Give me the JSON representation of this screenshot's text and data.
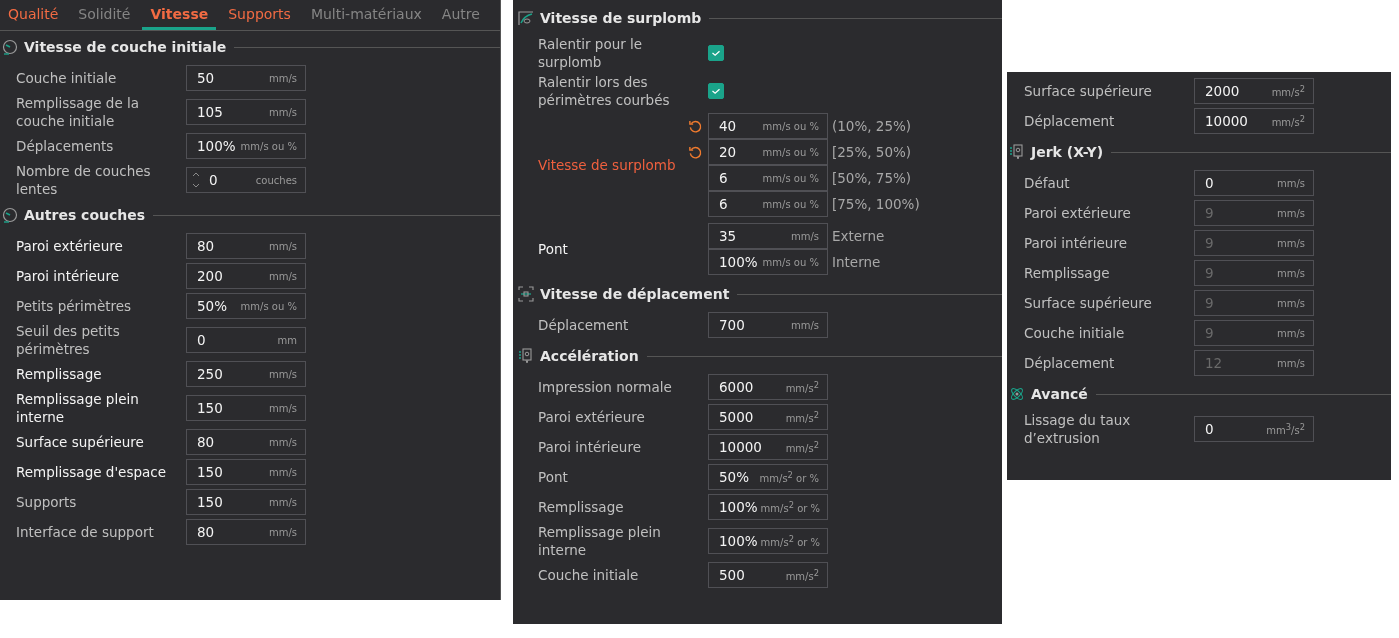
{
  "panels": [
    {
      "tabs": [
        {
          "label": "Qualité",
          "selected": false,
          "modified": true
        },
        {
          "label": "Solidité",
          "selected": false,
          "modified": false
        },
        {
          "label": "Vitesse",
          "selected": true,
          "modified": true
        },
        {
          "label": "Supports",
          "selected": false,
          "modified": true
        },
        {
          "label": "Multi-matériaux",
          "selected": false,
          "modified": false
        },
        {
          "label": "Autre",
          "selected": false,
          "modified": false
        }
      ],
      "sections": [
        {
          "title": "Vitesse de couche initiale",
          "kind": "gauge",
          "rows": [
            {
              "kind": "input",
              "label": "Couche initiale",
              "modified": false,
              "value": "50",
              "unit": "mm/s"
            },
            {
              "kind": "input",
              "label": "Remplissage de la couche initiale",
              "modified": false,
              "value": "105",
              "unit": "mm/s"
            },
            {
              "kind": "input",
              "label": "Déplacements",
              "modified": false,
              "value": "100%",
              "unit": "mm/s ou %"
            },
            {
              "kind": "spin",
              "label": "Nombre de couches lentes",
              "modified": false,
              "value": "0",
              "unit": "couches"
            }
          ]
        },
        {
          "title": "Autres couches",
          "kind": "gauge",
          "rows": [
            {
              "kind": "input",
              "label": "Paroi extérieure",
              "modified": true,
              "value": "80",
              "unit": "mm/s"
            },
            {
              "kind": "input",
              "label": "Paroi intérieure",
              "modified": true,
              "value": "200",
              "unit": "mm/s"
            },
            {
              "kind": "input",
              "label": "Petits périmètres",
              "modified": false,
              "value": "50%",
              "unit": "mm/s ou %"
            },
            {
              "kind": "input",
              "label": "Seuil des petits périmètres",
              "modified": false,
              "value": "0",
              "unit": "mm"
            },
            {
              "kind": "input",
              "label": "Remplissage",
              "modified": true,
              "value": "250",
              "unit": "mm/s"
            },
            {
              "kind": "input",
              "label": "Remplissage plein interne",
              "modified": true,
              "value": "150",
              "unit": "mm/s"
            },
            {
              "kind": "input",
              "label": "Surface supérieure",
              "modified": true,
              "value": "80",
              "unit": "mm/s"
            },
            {
              "kind": "input",
              "label": "Remplissage d'espace",
              "modified": true,
              "value": "150",
              "unit": "mm/s"
            },
            {
              "kind": "input",
              "label": "Supports",
              "modified": false,
              "value": "150",
              "unit": "mm/s"
            },
            {
              "kind": "input",
              "label": "Interface de support",
              "modified": false,
              "value": "80",
              "unit": "mm/s"
            }
          ]
        }
      ]
    },
    {
      "sections": [
        {
          "title": "Vitesse de surplomb",
          "kind": "overhang",
          "rows": [
            {
              "kind": "check",
              "label": "Ralentir pour le surplomb",
              "modified": false,
              "error": false,
              "checked": true
            },
            {
              "kind": "check",
              "label": "Ralentir lors des périmètres courbés",
              "modified": false,
              "error": false,
              "checked": true
            },
            {
              "kind": "multi",
              "label": "Vitesse de surplomb",
              "modified": false,
              "error": true,
              "inputs": [
                {
                  "value": "40",
                  "unit": "mm/s ou %",
                  "note": "(10%, 25%)",
                  "reset": true
                },
                {
                  "value": "20",
                  "unit": "mm/s ou %",
                  "note": "[25%, 50%)",
                  "reset": true
                },
                {
                  "value": "6",
                  "unit": "mm/s ou %",
                  "note": "[50%, 75%)",
                  "reset": false
                },
                {
                  "value": "6",
                  "unit": "mm/s ou %",
                  "note": "[75%, 100%)",
                  "reset": false
                }
              ]
            },
            {
              "kind": "multi",
              "label": "Pont",
              "modified": true,
              "error": false,
              "inputs": [
                {
                  "value": "35",
                  "unit": "mm/s",
                  "note": "Externe",
                  "reset": false
                },
                {
                  "value": "100%",
                  "unit": "mm/s ou %",
                  "note": "Interne",
                  "reset": false
                }
              ]
            }
          ]
        },
        {
          "title": "Vitesse de déplacement",
          "kind": "travel",
          "rows": [
            {
              "kind": "input",
              "label": "Déplacement",
              "modified": false,
              "value": "700",
              "unit": "mm/s"
            }
          ]
        },
        {
          "title": "Accélération",
          "kind": "printhead",
          "rows": [
            {
              "kind": "input",
              "label": "Impression normale",
              "modified": false,
              "value": "6000",
              "unit": "mm/s$^{2}$"
            },
            {
              "kind": "input",
              "label": "Paroi extérieure",
              "modified": false,
              "value": "5000",
              "unit": "mm/s$^{2}$"
            },
            {
              "kind": "input",
              "label": "Paroi intérieure",
              "modified": false,
              "value": "10000",
              "unit": "mm/s$^{2}$"
            },
            {
              "kind": "input",
              "label": "Pont",
              "modified": false,
              "value": "50%",
              "unit": "mm/s$^{2}$ or %"
            },
            {
              "kind": "input",
              "label": "Remplissage",
              "modified": false,
              "value": "100%",
              "unit": "mm/s$^{2}$ or %"
            },
            {
              "kind": "input",
              "label": "Remplissage plein interne",
              "modified": false,
              "value": "100%",
              "unit": "mm/s$^{2}$ or %"
            },
            {
              "kind": "input",
              "label": "Couche initiale",
              "modified": false,
              "value": "500",
              "unit": "mm/s$^{2}$"
            }
          ]
        }
      ]
    },
    {
      "sections": [
        {
          "rows": [
            {
              "kind": "input",
              "label": "Surface supérieure",
              "modified": false,
              "value": "2000",
              "unit": "mm/s$^{2}$"
            },
            {
              "kind": "input",
              "label": "Déplacement",
              "modified": false,
              "value": "10000",
              "unit": "mm/s$^{2}$"
            }
          ]
        },
        {
          "title": "Jerk (X-Y)",
          "kind": "printhead",
          "rows": [
            {
              "kind": "input",
              "label": "Défaut",
              "modified": false,
              "value": "0",
              "unit": "mm/s",
              "disabled": false
            },
            {
              "kind": "input",
              "label": "Paroi extérieure",
              "modified": false,
              "value": "9",
              "unit": "mm/s",
              "disabled": true
            },
            {
              "kind": "input",
              "label": "Paroi intérieure",
              "modified": false,
              "value": "9",
              "unit": "mm/s",
              "disabled": true
            },
            {
              "kind": "input",
              "label": "Remplissage",
              "modified": false,
              "value": "9",
              "unit": "mm/s",
              "disabled": true
            },
            {
              "kind": "input",
              "label": "Surface supérieure",
              "modified": false,
              "value": "9",
              "unit": "mm/s",
              "disabled": true
            },
            {
              "kind": "input",
              "label": "Couche initiale",
              "modified": false,
              "value": "9",
              "unit": "mm/s",
              "disabled": true
            },
            {
              "kind": "input",
              "label": "Déplacement",
              "modified": false,
              "value": "12",
              "unit": "mm/s",
              "disabled": true
            }
          ]
        },
        {
          "title": "Avancé",
          "kind": "atom",
          "rows": [
            {
              "kind": "input",
              "label": "Lissage du taux d’extrusion",
              "modified": false,
              "value": "0",
              "unit": "mm$^{3}$/s$^{2}$"
            }
          ]
        }
      ]
    }
  ]
}
